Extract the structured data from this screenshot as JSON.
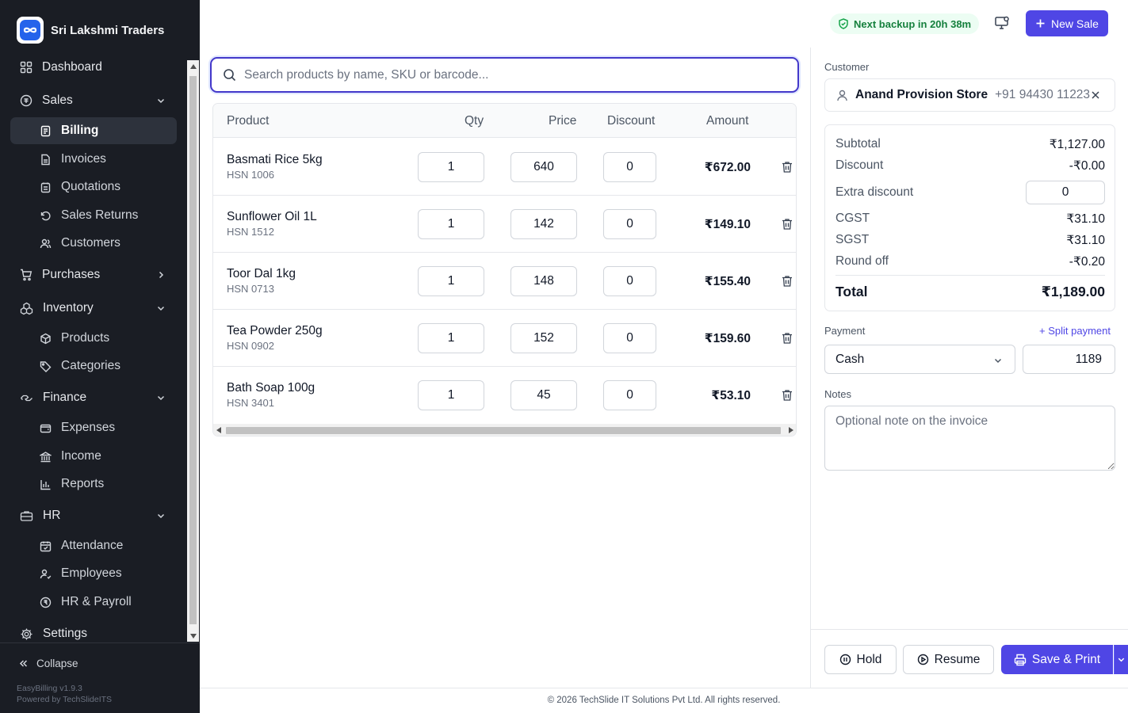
{
  "brand": {
    "name": "Sri Lakshmi Traders",
    "logo_icon": "infinity-logo"
  },
  "nav": [
    {
      "label": "Dashboard",
      "icon": "dashboard-icon",
      "type": "top"
    },
    {
      "label": "Sales",
      "icon": "sales-icon",
      "type": "group",
      "expanded": true
    },
    {
      "label": "Billing",
      "icon": "billing-icon",
      "type": "sub",
      "active": true
    },
    {
      "label": "Invoices",
      "icon": "invoice-icon",
      "type": "sub"
    },
    {
      "label": "Quotations",
      "icon": "quotation-icon",
      "type": "sub"
    },
    {
      "label": "Sales Returns",
      "icon": "return-icon",
      "type": "sub"
    },
    {
      "label": "Customers",
      "icon": "customers-icon",
      "type": "sub"
    },
    {
      "label": "Purchases",
      "icon": "cart-icon",
      "type": "group",
      "expanded": false
    },
    {
      "label": "Inventory",
      "icon": "inventory-icon",
      "type": "group",
      "expanded": true
    },
    {
      "label": "Products",
      "icon": "product-icon",
      "type": "sub"
    },
    {
      "label": "Categories",
      "icon": "tag-icon",
      "type": "sub"
    },
    {
      "label": "Finance",
      "icon": "finance-icon",
      "type": "group",
      "expanded": true
    },
    {
      "label": "Expenses",
      "icon": "wallet-icon",
      "type": "sub"
    },
    {
      "label": "Income",
      "icon": "bank-icon",
      "type": "sub"
    },
    {
      "label": "Reports",
      "icon": "reports-icon",
      "type": "sub"
    },
    {
      "label": "HR",
      "icon": "briefcase-icon",
      "type": "group",
      "expanded": true
    },
    {
      "label": "Attendance",
      "icon": "calendar-icon",
      "type": "sub"
    },
    {
      "label": "Employees",
      "icon": "employees-icon",
      "type": "sub"
    },
    {
      "label": "HR & Payroll",
      "icon": "payroll-icon",
      "type": "sub"
    },
    {
      "label": "Settings",
      "icon": "gear-icon",
      "type": "top"
    }
  ],
  "sidebar_footer": {
    "collapse_label": "Collapse",
    "version": "EasyBilling v1.9.3",
    "powered_by": "Powered by TechSlideITS"
  },
  "topbar": {
    "backup_text": "Next backup in 20h 38m",
    "new_sale_label": "New Sale",
    "accent": "#4f46e5"
  },
  "search": {
    "placeholder": "Search products by name, SKU or barcode...",
    "value": ""
  },
  "table": {
    "headers": {
      "product": "Product",
      "qty": "Qty",
      "price": "Price",
      "discount": "Discount",
      "amount": "Amount"
    },
    "rows": [
      {
        "name": "Basmati Rice 5kg",
        "hsn": "HSN 1006",
        "qty": "1",
        "price": "640",
        "discount": "0",
        "amount": "₹672.00"
      },
      {
        "name": "Sunflower Oil 1L",
        "hsn": "HSN 1512",
        "qty": "1",
        "price": "142",
        "discount": "0",
        "amount": "₹149.10"
      },
      {
        "name": "Toor Dal 1kg",
        "hsn": "HSN 0713",
        "qty": "1",
        "price": "148",
        "discount": "0",
        "amount": "₹155.40"
      },
      {
        "name": "Tea Powder 250g",
        "hsn": "HSN 0902",
        "qty": "1",
        "price": "152",
        "discount": "0",
        "amount": "₹159.60"
      },
      {
        "name": "Bath Soap 100g",
        "hsn": "HSN 3401",
        "qty": "1",
        "price": "45",
        "discount": "0",
        "amount": "₹53.10"
      }
    ]
  },
  "customer": {
    "label": "Customer",
    "name": "Anand Provision Store",
    "phone": "+91 94430 11223"
  },
  "summary": {
    "subtotal_label": "Subtotal",
    "subtotal": "₹1,127.00",
    "discount_label": "Discount",
    "discount": "-₹0.00",
    "extra_label": "Extra discount",
    "extra_value": "0",
    "cgst_label": "CGST",
    "cgst": "₹31.10",
    "sgst_label": "SGST",
    "sgst": "₹31.10",
    "round_label": "Round off",
    "round": "-₹0.20",
    "total_label": "Total",
    "total": "₹1,189.00"
  },
  "payment": {
    "label": "Payment",
    "split_label": "+ Split payment",
    "method": "Cash",
    "amount": "1189"
  },
  "notes": {
    "label": "Notes",
    "placeholder": "Optional note on the invoice"
  },
  "actions": {
    "hold": "Hold",
    "resume": "Resume",
    "save_print": "Save & Print"
  },
  "footer": "© 2026 TechSlide IT Solutions Pvt Ltd. All rights reserved."
}
